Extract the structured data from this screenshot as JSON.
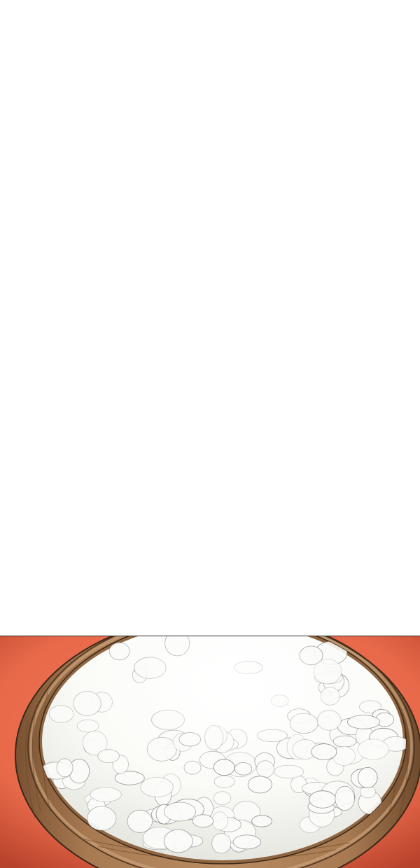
{
  "page": {
    "background_color": "#ffffff"
  },
  "panel": {
    "subject": "bowl-of-rice-illustration",
    "colors": {
      "backdrop": "#e8694a",
      "backdrop_shadow": "#b8432c",
      "bowl_wood": "#a87a52",
      "bowl_wood_dark": "#6e4a2c",
      "bowl_rim_highlight": "#c9a27a",
      "rice": "#fbfbf8",
      "rice_shadow": "#d8d9d3",
      "line_ink": "#3a3a3a"
    }
  }
}
